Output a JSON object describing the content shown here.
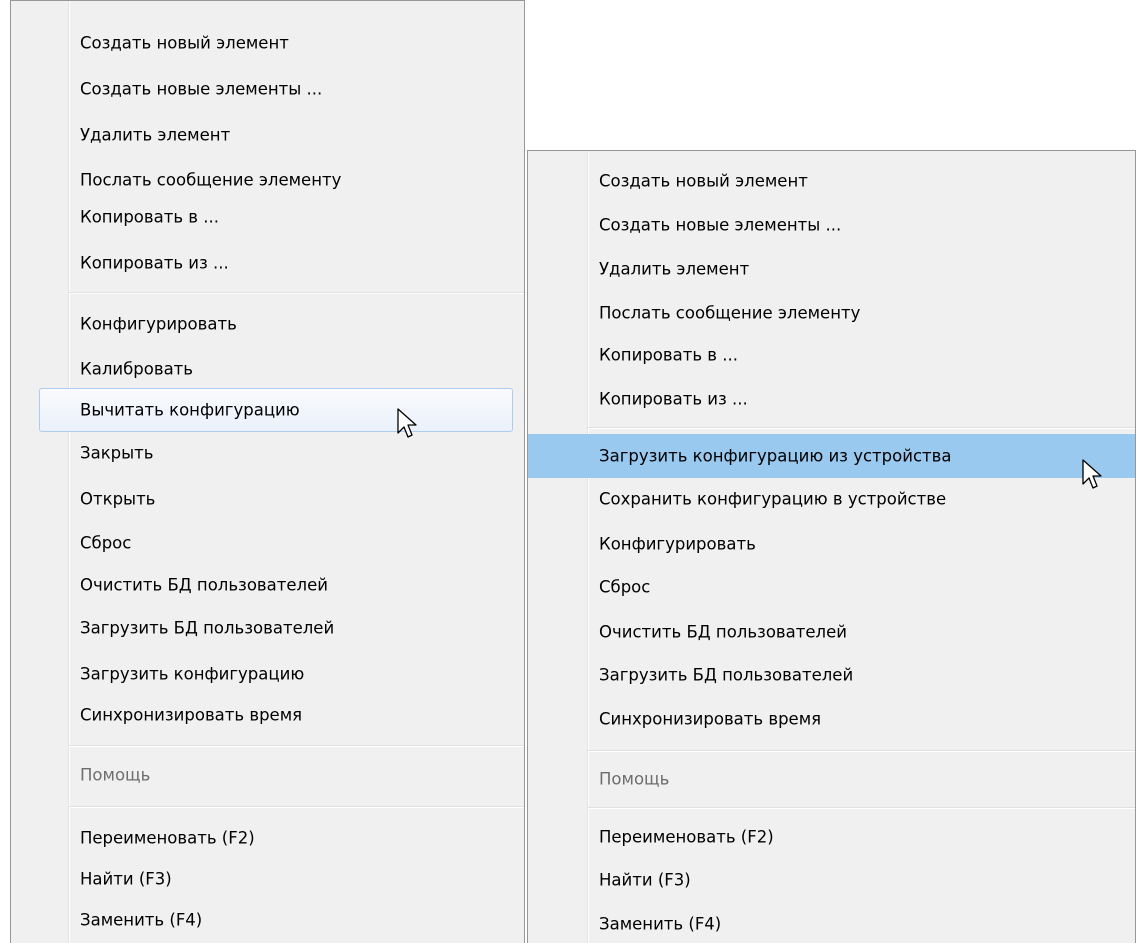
{
  "menu_left": {
    "group1": [
      "Создать новый элемент",
      "Создать новые элементы ...",
      "Удалить элемент",
      "Послать сообщение элементу",
      "Копировать в ...",
      "Копировать из ..."
    ],
    "group2": [
      "Конфигурировать",
      "Калибровать",
      "Вычитать конфигурацию",
      "Закрыть",
      "Открыть",
      "Сброс",
      "Очистить БД пользователей",
      "Загрузить БД пользователей",
      "Загрузить конфигурацию",
      "Синхронизировать время"
    ],
    "help": "Помощь",
    "group3": [
      "Переименовать (F2)",
      "Найти (F3)",
      "Заменить (F4)"
    ],
    "highlighted": "Вычитать конфигурацию"
  },
  "menu_right": {
    "group1": [
      "Создать новый элемент",
      "Создать новые элементы ...",
      "Удалить элемент",
      "Послать сообщение элементу",
      "Копировать в ...",
      "Копировать из ..."
    ],
    "group2": [
      "Загрузить конфигурацию из устройства",
      "Сохранить конфигурацию в устройстве",
      "Конфигурировать",
      "Сброс",
      "Очистить БД пользователей",
      "Загрузить БД пользователей",
      "Синхронизировать время"
    ],
    "help": "Помощь",
    "group3": [
      "Переименовать (F2)",
      "Найти (F3)",
      "Заменить (F4)"
    ],
    "highlighted": "Загрузить конфигурацию из устройства"
  },
  "colors": {
    "menu_bg": "#f0f0f0",
    "highlight_solid": "#99c9ef",
    "highlight_soft_border": "#aeccf0",
    "disabled_text": "#6d6d6d"
  },
  "icons": {
    "cursor": "arrow-cursor-icon"
  }
}
